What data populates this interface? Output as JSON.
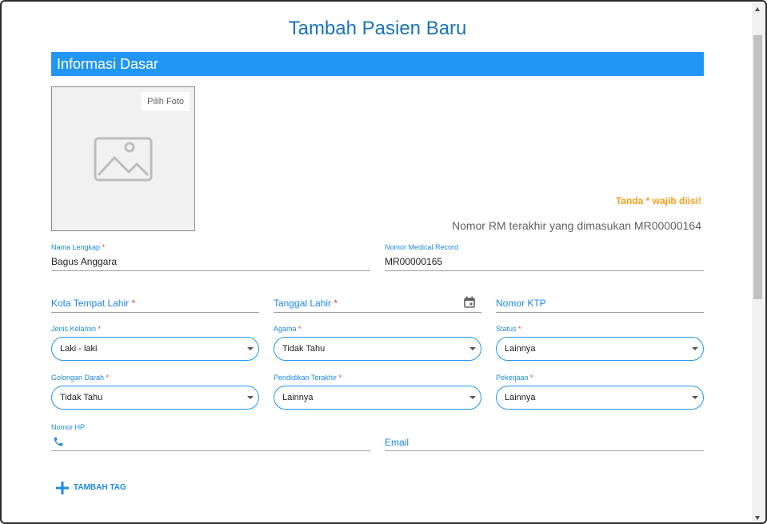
{
  "title": "Tambah Pasien Baru",
  "section": {
    "label": "Informasi Dasar"
  },
  "photo": {
    "button_label": "Pilih Foto"
  },
  "required_note": "Tanda * wajib diisi!",
  "last_rm": "Nomor RM terakhir yang dimasukan MR00000164",
  "fields": {
    "nama": {
      "label": "Nama Lengkap",
      "required": "*",
      "value": "Bagus Anggara"
    },
    "nomor_mr": {
      "label": "Nomor Medical Record",
      "value": "MR00000165"
    },
    "kota_lahir": {
      "label": "Kota Tempat Lahir",
      "required": "*"
    },
    "tanggal_lahir": {
      "label": "Tanggal Lahir",
      "required": "*"
    },
    "ktp": {
      "label": "Nomor KTP"
    },
    "nomor_hp": {
      "label": "Nomor HP"
    },
    "email": {
      "label": "Email"
    }
  },
  "selects": {
    "jenis_kelamin": {
      "label": "Jenis Kelamin",
      "required": "*",
      "value": "Laki - laki"
    },
    "agama": {
      "label": "Agama",
      "required": "*",
      "value": "Tidak Tahu"
    },
    "status": {
      "label": "Status",
      "required": "*",
      "value": "Lainnya"
    },
    "golongan_darah": {
      "label": "Golongan Darah",
      "required": "*",
      "value": "Tidak Tahu"
    },
    "pendidikan": {
      "label": "Pendidikan Terakhir",
      "required": "*",
      "value": "Lainnya"
    },
    "pekerjaan": {
      "label": "Pekerjaan",
      "required": "*",
      "value": "Lainnya"
    }
  },
  "tag_button": {
    "label": "TAMBAH TAG"
  },
  "icons": {
    "photo_placeholder": "image-icon",
    "calendar": "calendar-icon",
    "phone": "phone-icon",
    "plus": "plus-icon"
  },
  "colors": {
    "primary": "#2196f3",
    "title": "#1a73b8",
    "required": "#e53935",
    "note": "#f4a01c"
  }
}
